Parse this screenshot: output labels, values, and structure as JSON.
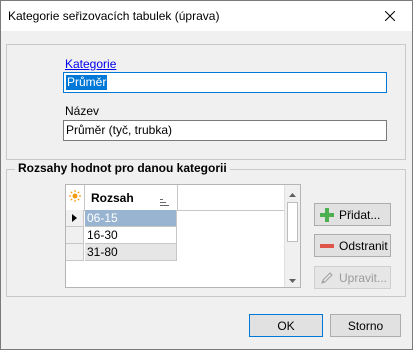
{
  "window": {
    "title": "Kategorie seřizovacích tabulek (úprava)"
  },
  "form": {
    "category_label": "Kategorie",
    "category_value": "Průměr",
    "name_label": "Název",
    "name_value": "Průměr (tyč, trubka)"
  },
  "ranges": {
    "group_title": "Rozsahy hodnot pro danou kategorii",
    "column_header": "Rozsah",
    "rows": [
      "06-15",
      "16-30",
      "31-80"
    ],
    "selected_index": 0
  },
  "buttons": {
    "add": "Přidat...",
    "remove": "Odstranit",
    "edit": "Upravit...",
    "ok": "OK",
    "cancel": "Storno"
  },
  "icons": {
    "close": "close-icon",
    "add": "plus-icon",
    "remove": "minus-icon",
    "edit": "pencil-icon",
    "column_options": "sun-icon",
    "sort": "sort-icon"
  },
  "colors": {
    "accent": "#0078d7",
    "selection": "#99b4d1",
    "add_green": "#4caf50",
    "remove_red": "#e0554a",
    "link": "#0000ee"
  }
}
